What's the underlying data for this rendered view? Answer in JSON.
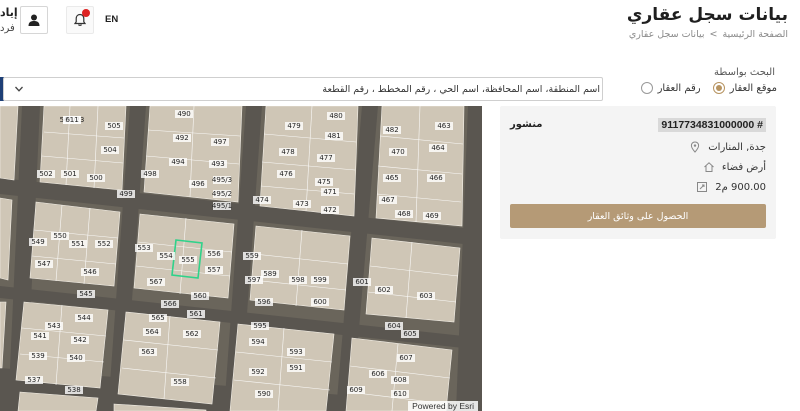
{
  "header": {
    "title": "بيانات سجل عقاري",
    "breadcrumb": {
      "home": "الصفحة الرئيسية",
      "separator": ">",
      "current": "بيانات سجل عقاري"
    },
    "user": {
      "name": "إياد",
      "role": "فرد"
    },
    "language_toggle": "EN",
    "icons": {
      "avatar": "user-icon",
      "notifications": "bell-icon"
    }
  },
  "search": {
    "label": "البحث بواسطة",
    "options": [
      {
        "label": "رقم العقار",
        "selected": false
      },
      {
        "label": "موقع العقار",
        "selected": true
      }
    ],
    "placeholder": "اسم المنطقة، اسم المحافظة، اسم الحي ، رقم المخطط ، رقم القطعة"
  },
  "map": {
    "attribution": "Powered by Esri",
    "parcel_labels": [
      "506/23",
      "505",
      "504",
      "500",
      "502",
      "501",
      "490",
      "492",
      "494",
      "493",
      "497",
      "498",
      "496",
      "495/3",
      "495/2",
      "495/1",
      "499",
      "480",
      "479",
      "478",
      "477",
      "476",
      "475",
      "474",
      "473",
      "472",
      "471",
      "481",
      "482",
      "470",
      "464",
      "465",
      "466",
      "467",
      "468",
      "469",
      "463",
      "549",
      "550",
      "551",
      "552",
      "553",
      "554",
      "555",
      "556",
      "557",
      "546",
      "547",
      "545",
      "544",
      "543",
      "542",
      "541",
      "540",
      "539",
      "538",
      "537",
      "567",
      "566",
      "565",
      "564",
      "563",
      "562",
      "561",
      "560",
      "558",
      "559",
      "597",
      "596",
      "595",
      "594",
      "593",
      "592",
      "591",
      "590",
      "589",
      "598",
      "599",
      "600",
      "601",
      "602",
      "603",
      "604",
      "605",
      "606",
      "607",
      "608",
      "609",
      "610",
      "611"
    ]
  },
  "parcel": {
    "id": "9117734831000000 #",
    "status": "منشور",
    "location": "جدة, المنارات",
    "type": "أرض فضاء",
    "area": "900.00 م2",
    "get_docs_button": "الحصول على وثائق العقار",
    "icons": {
      "location": "map-pin-icon",
      "type": "home-icon",
      "area": "area-icon"
    }
  },
  "colors": {
    "accent": "#b79461",
    "button": "#b59a76",
    "nav_blue": "#1e3f76"
  }
}
